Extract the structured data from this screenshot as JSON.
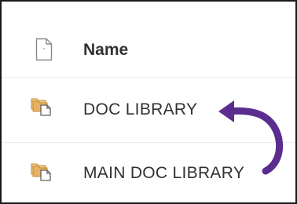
{
  "list": {
    "header": {
      "column_label": "Name",
      "icon": "file-icon"
    },
    "items": [
      {
        "label": "DOC LIBRARY",
        "icon": "library-folder-icon"
      },
      {
        "label": "MAIN DOC LIBRARY",
        "icon": "library-folder-icon"
      }
    ]
  },
  "annotation": {
    "icon": "curved-arrow-icon",
    "color": "#5b2d8e"
  },
  "colors": {
    "folder": "#d9a24f",
    "text": "#323130"
  }
}
